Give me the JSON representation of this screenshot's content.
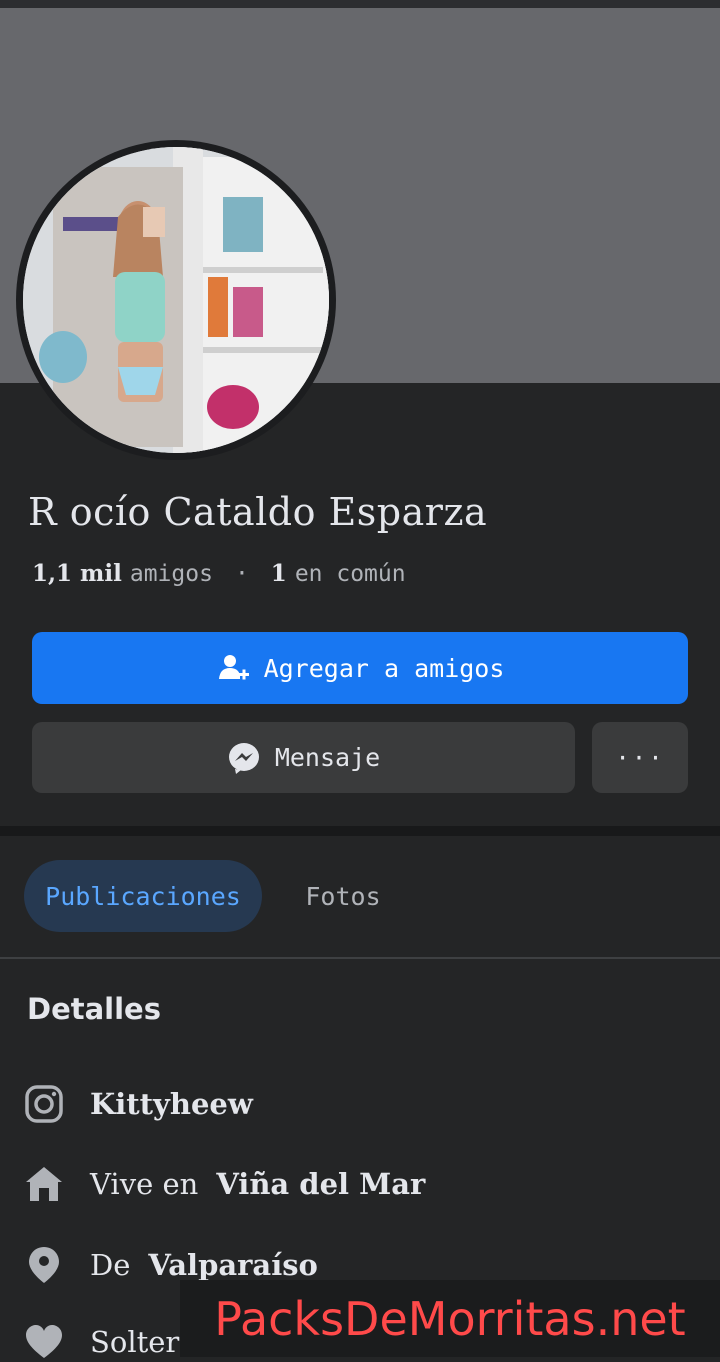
{
  "profile": {
    "name": "R ocío Cataldo Esparza",
    "friends_count": "1,1 mil",
    "friends_label": "amigos",
    "separator": "·",
    "mutual_count": "1",
    "mutual_label": "en común"
  },
  "actions": {
    "add_friend_label": "Agregar a amigos",
    "message_label": "Mensaje",
    "more_label": "···"
  },
  "tabs": [
    {
      "label": "Publicaciones",
      "active": true
    },
    {
      "label": "Fotos",
      "active": false
    }
  ],
  "details": {
    "title": "Detalles",
    "items": [
      {
        "icon": "instagram-icon",
        "prefix": "",
        "value": "Kittyheew"
      },
      {
        "icon": "home-icon",
        "prefix": "Vive en",
        "value": "Viña del Mar"
      },
      {
        "icon": "location-pin-icon",
        "prefix": "De",
        "value": "Valparaíso"
      },
      {
        "icon": "heart-icon",
        "prefix": "",
        "value": "Solter"
      }
    ]
  },
  "watermark": {
    "text": "PacksDeMorritas.net"
  },
  "colors": {
    "background": "#242526",
    "cover": "#67686c",
    "primary_button": "#1877f2",
    "secondary_button": "#3a3b3c",
    "active_tab_text": "#5aa7ff",
    "watermark": "#ff4a4a"
  }
}
